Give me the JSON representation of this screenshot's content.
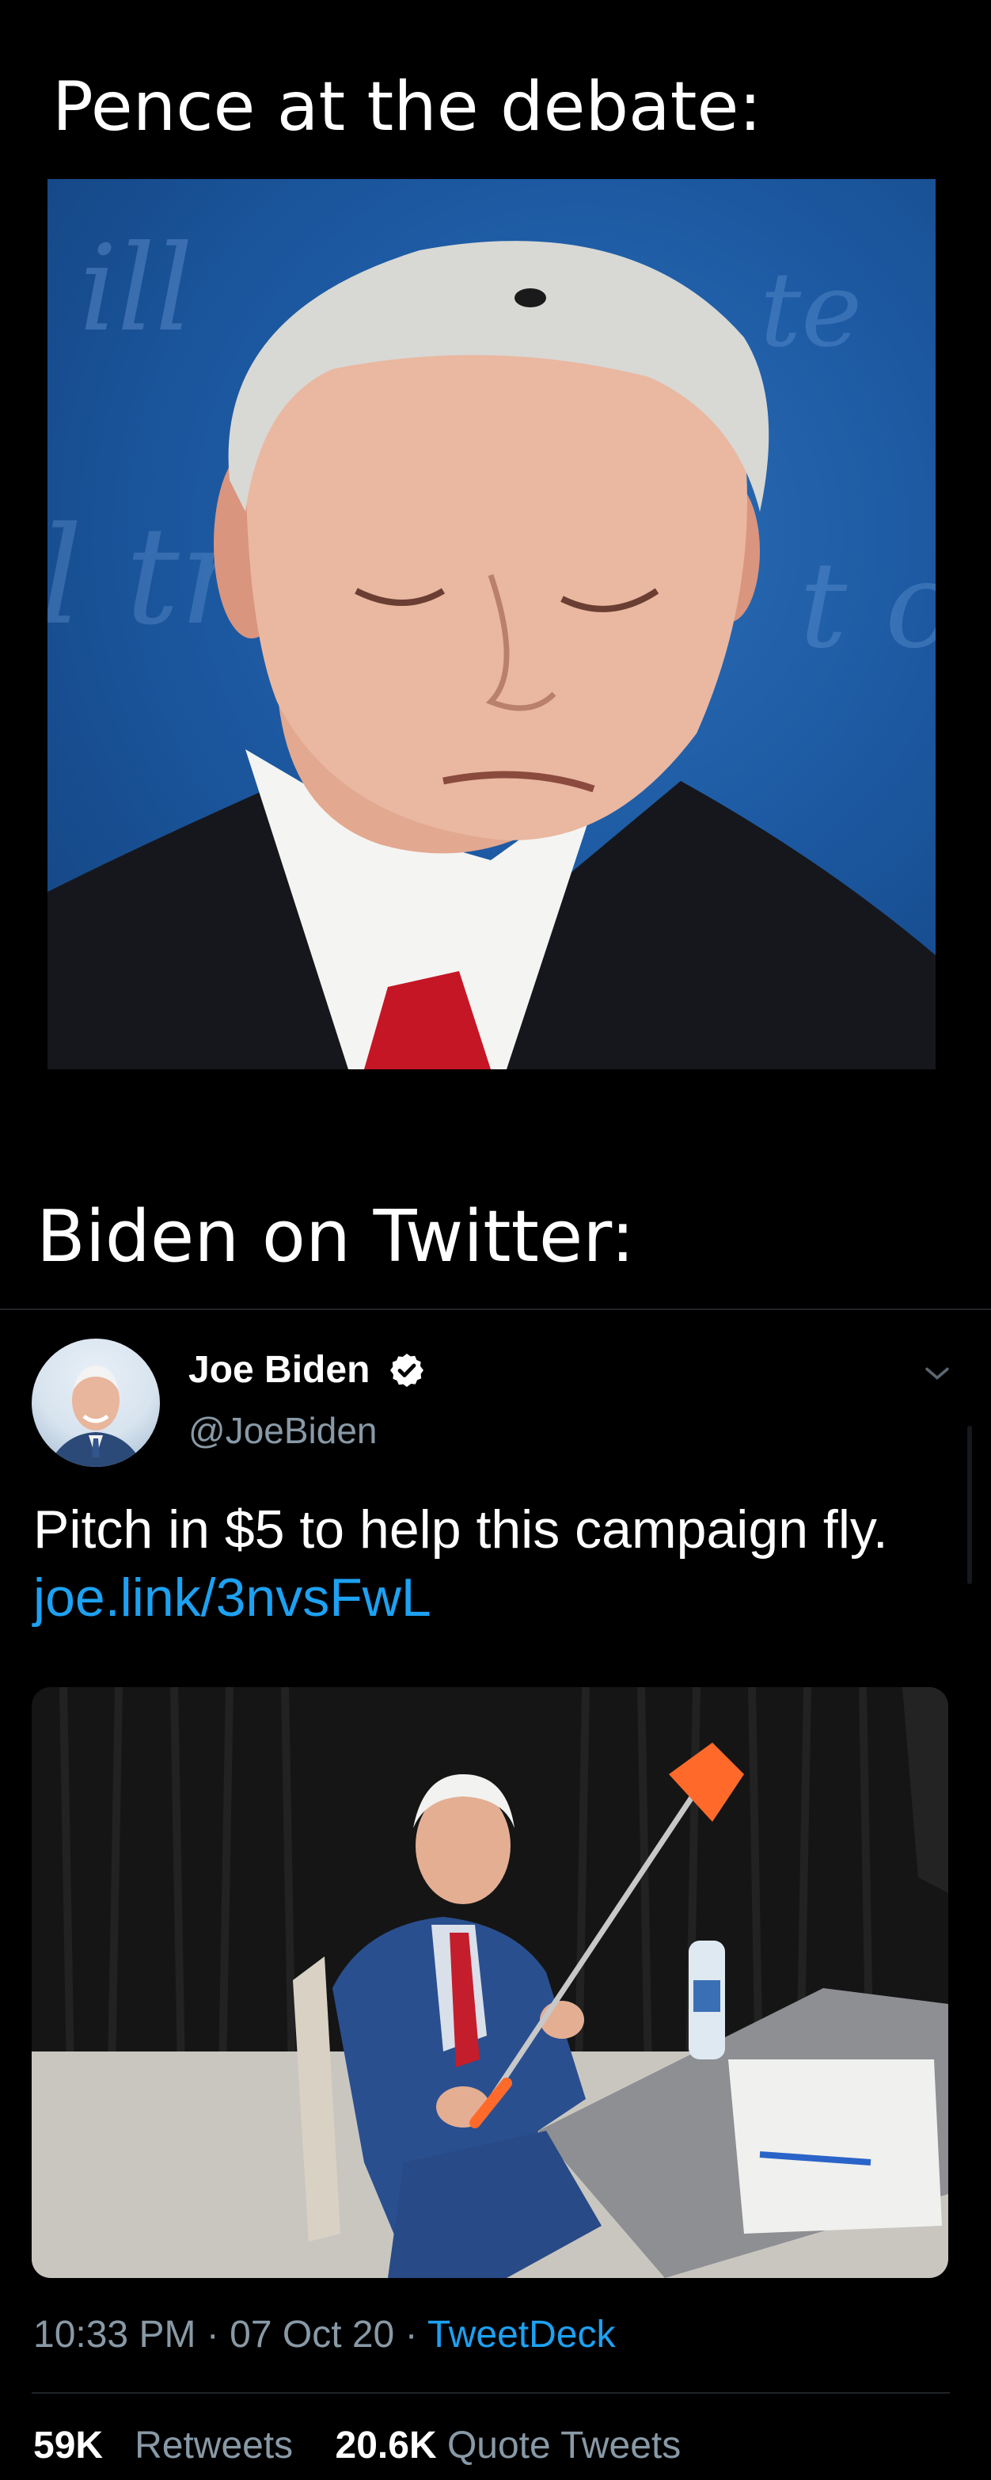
{
  "meme": {
    "caption_top": "Pence at the debate:",
    "caption_bottom": "Biden on Twitter:"
  },
  "tweet": {
    "display_name": "Joe Biden",
    "handle": "@JoeBiden",
    "verified": true,
    "text": "Pitch in $5 to help this campaign fly.",
    "link": "joe.link/3nvsFwL",
    "time": "10:33 PM",
    "date": "07 Oct 20",
    "separator": "·",
    "source": "TweetDeck",
    "retweets_count": "59K",
    "retweets_label": "Retweets",
    "quote_count": "20.6K",
    "quote_label": "Quote Tweets"
  },
  "icons": {
    "verified": "verified-badge-icon",
    "more": "chevron-down-icon"
  },
  "colors": {
    "background": "#000000",
    "link": "#1da1f2",
    "secondary_text": "#8899a6",
    "divider": "#1f2327"
  }
}
